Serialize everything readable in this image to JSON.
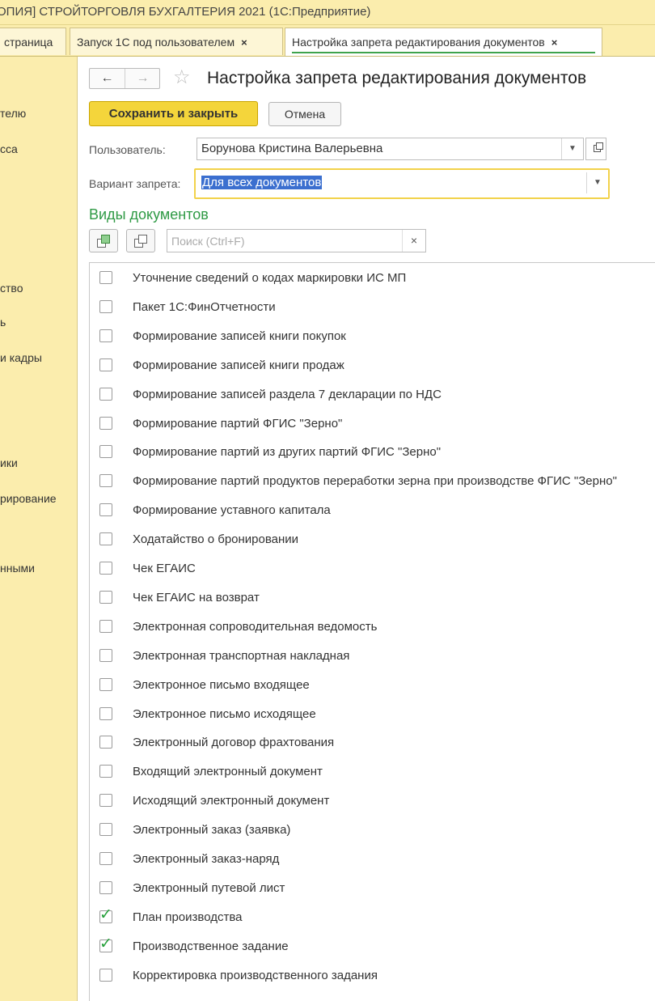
{
  "window": {
    "title": "ОПИЯ] СТРОЙТОРГОВЛЯ БУХГАЛТЕРИЯ 2021  (1С:Предприятие)"
  },
  "tabs": [
    {
      "label": "страница",
      "closable": false,
      "active": false
    },
    {
      "label": "Запуск 1С под пользователем",
      "closable": true,
      "active": false
    },
    {
      "label": "Настройка запрета редактирования документов",
      "closable": true,
      "active": true
    }
  ],
  "close_glyph": "×",
  "sidebar": {
    "items": [
      "телю",
      "сса",
      "ство",
      "ь",
      "и кадры",
      "ики",
      "рирование",
      "нными"
    ]
  },
  "nav": {
    "back_icon": "arrow-left-icon",
    "forward_icon": "arrow-right-icon"
  },
  "form": {
    "title": "Настройка запрета редактирования документов",
    "save_close_label": "Сохранить и закрыть",
    "cancel_label": "Отмена",
    "user_label": "Пользователь:",
    "user_value": "Борунова Кристина Валерьевна",
    "variant_label": "Вариант запрета:",
    "variant_value": "Для всех документов",
    "section_title": "Виды документов",
    "search_placeholder": "Поиск (Ctrl+F)",
    "search_value": ""
  },
  "colors": {
    "accent_green": "#2f9a45",
    "primary_button": "#f4d53b",
    "panel_background": "#fbedad",
    "selection": "#3b6fcf"
  },
  "documents": [
    {
      "label": "Уточнение сведений о кодах маркировки ИС МП",
      "checked": false
    },
    {
      "label": "Пакет 1С:ФинОтчетности",
      "checked": false
    },
    {
      "label": "Формирование записей книги покупок",
      "checked": false
    },
    {
      "label": "Формирование записей книги продаж",
      "checked": false
    },
    {
      "label": "Формирование записей раздела 7 декларации по НДС",
      "checked": false
    },
    {
      "label": "Формирование партий ФГИС \"Зерно\"",
      "checked": false
    },
    {
      "label": "Формирование партий из других партий ФГИС \"Зерно\"",
      "checked": false
    },
    {
      "label": "Формирование партий продуктов переработки зерна при производстве ФГИС \"Зерно\"",
      "checked": false
    },
    {
      "label": "Формирование уставного капитала",
      "checked": false
    },
    {
      "label": "Ходатайство о бронировании",
      "checked": false
    },
    {
      "label": "Чек ЕГАИС",
      "checked": false
    },
    {
      "label": "Чек ЕГАИС на возврат",
      "checked": false
    },
    {
      "label": "Электронная сопроводительная ведомость",
      "checked": false
    },
    {
      "label": "Электронная транспортная накладная",
      "checked": false
    },
    {
      "label": "Электронное письмо входящее",
      "checked": false
    },
    {
      "label": "Электронное письмо исходящее",
      "checked": false
    },
    {
      "label": "Электронный договор фрахтования",
      "checked": false
    },
    {
      "label": "Входящий электронный документ",
      "checked": false
    },
    {
      "label": "Исходящий электронный документ",
      "checked": false
    },
    {
      "label": "Электронный заказ (заявка)",
      "checked": false
    },
    {
      "label": "Электронный заказ-наряд",
      "checked": false
    },
    {
      "label": "Электронный путевой лист",
      "checked": false
    },
    {
      "label": "План производства",
      "checked": true
    },
    {
      "label": "Производственное задание",
      "checked": true
    },
    {
      "label": "Корректировка производственного задания",
      "checked": false
    }
  ]
}
